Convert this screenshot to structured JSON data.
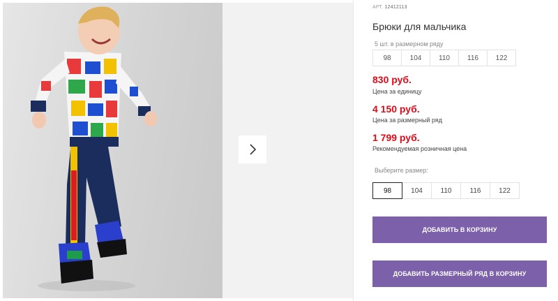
{
  "product": {
    "article_label": "АРТ.",
    "article_code": "12412113",
    "title": "Брюки для мальчика",
    "pack_label": "5 шт. в размерном ряду",
    "pack_sizes": [
      "98",
      "104",
      "110",
      "116",
      "122"
    ],
    "prices": [
      {
        "value": "830 руб.",
        "caption": "Цена за единицу"
      },
      {
        "value": "4 150 руб.",
        "caption": "Цена за размерный ряд"
      },
      {
        "value": "1 799 руб.",
        "caption": "Рекомендуемая розничная цена"
      }
    ],
    "select_label": "Выберите размер:",
    "sizes": [
      "98",
      "104",
      "110",
      "116",
      "122"
    ],
    "selected_size": "98"
  },
  "buttons": {
    "add_to_cart": "ДОБАВИТЬ В КОРЗИНУ",
    "add_row_to_cart": "ДОБАВИТЬ РАЗМЕРНЫЙ РЯД В КОРЗИНУ"
  },
  "gallery": {
    "next_icon": "chevron-right-icon"
  },
  "colors": {
    "price": "#e20a17",
    "button": "#7c60a9"
  }
}
